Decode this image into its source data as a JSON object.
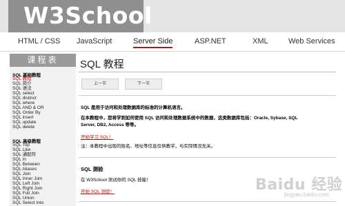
{
  "header": {
    "logo": "W3School"
  },
  "nav": {
    "items": [
      "HTML / CSS",
      "JavaScript",
      "Server Side",
      "ASP.NET",
      "XML",
      "Web Services"
    ],
    "active": "Server Side"
  },
  "sidebar": {
    "title": "课程表",
    "basic": {
      "heading": "SQL 基础教程",
      "items": [
        "SQL 教程",
        "SQL 简介",
        "SQL 语法",
        "SQL select",
        "SQL distinct",
        "SQL where",
        "SQL AND & OR",
        "SQL Order By",
        "SQL insert",
        "SQL update",
        "SQL delete"
      ]
    },
    "advanced": {
      "heading": "SQL 高级教程",
      "items": [
        "SQL Top",
        "SQL Like",
        "SQL 通配符",
        "SQL In",
        "SQL Between",
        "SQL Aliases",
        "SQL Join",
        "SQL Inner Join",
        "SQL Left Join",
        "SQL Right Join",
        "SQL Full Join",
        "SQL Union",
        "SQL Select Into"
      ]
    }
  },
  "main": {
    "title": "SQL 教程",
    "prev": "上一节",
    "next": "下一节",
    "p1": "SQL 是用于访问和处理数据库的标准的计算机语言。",
    "p2a": "在本教程中，您将学到如何使用 SQL 访问和处理数据系统中的数据，这类数据库包括：Oracle, Sybase, SQL",
    "p2b": "Server, DB2, Access 等等。",
    "link1": "开始学习 SQL！",
    "note": "注：本教程中出现的姓名、地址等信息仅供教学，与实际情况无关。",
    "quiz_title": "SQL 测验",
    "quiz_text": "在 W3School 测试你的 SQL 技能！",
    "quiz_link": "开始 SQL 测验！"
  },
  "watermark": {
    "main": "Baidu 经验",
    "sub": "jingyan.baidu.com"
  }
}
